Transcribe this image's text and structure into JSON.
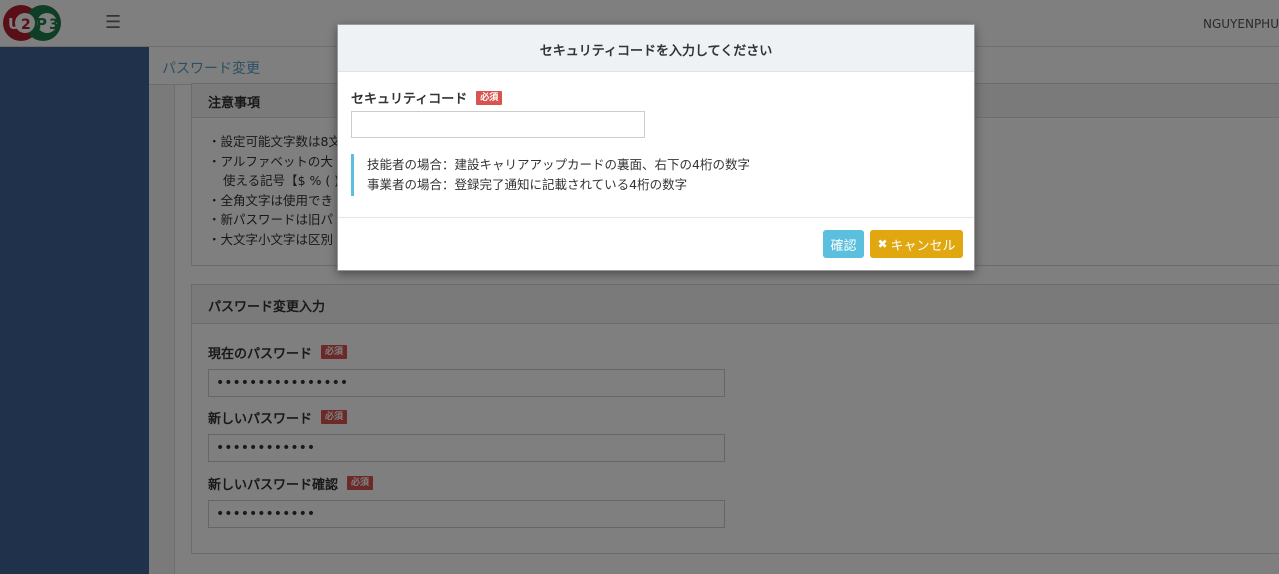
{
  "header": {
    "logo_letters": [
      "U",
      "2",
      "P",
      "3"
    ],
    "menu_icon": "hamburger-icon",
    "username": "NGUYENPHU"
  },
  "page": {
    "title": "パスワード変更"
  },
  "notice": {
    "heading": "注意事項",
    "items": [
      "・設定可能文字数は8文",
      "・アルファベットの大",
      "使える記号【$ % ( )",
      "・全角文字は使用でき",
      "・新パスワードは旧パ",
      "・大文字小文字は区別"
    ]
  },
  "password_form": {
    "heading": "パスワード変更入力",
    "required_badge": "必須",
    "current_label": "現在のパスワード",
    "current_value": "••••••••••••••••",
    "new_label": "新しいパスワード",
    "new_value": "••••••••••••",
    "confirm_label": "新しいパスワード確認",
    "confirm_value": "••••••••••••"
  },
  "modal": {
    "title": "セキュリティコードを入力してください",
    "field_label": "セキュリティコード",
    "required_badge": "必須",
    "field_value": "",
    "hint_line1": "技能者の場合：建設キャリアアップカードの裏面、右下の4桁の数字",
    "hint_line2": "事業者の場合：登録完了通知に記載されている4桁の数字",
    "confirm_label": "確認",
    "cancel_icon": "close-icon",
    "cancel_label": "キャンセル"
  },
  "colors": {
    "sidebar": "#3e6396",
    "title_text": "#5aa0c8",
    "required_badge": "#d9534f",
    "confirm_button": "#5bc0de",
    "cancel_button": "#e0a711"
  }
}
